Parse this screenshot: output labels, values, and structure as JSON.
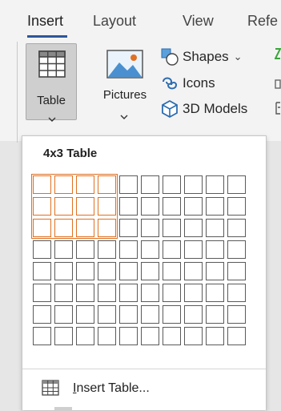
{
  "ribbon": {
    "tabs": [
      {
        "label": "Insert",
        "active": true
      },
      {
        "label": "Layout",
        "active": false
      },
      {
        "label": "View",
        "active": false
      },
      {
        "label": "Refe",
        "active": false
      }
    ],
    "table_button": {
      "label": "Table",
      "icon": "table-icon",
      "pressed": true
    },
    "pictures_button": {
      "label": "Pictures",
      "icon": "pictures-icon"
    },
    "shapes": {
      "label": "Shapes",
      "icon": "shapes-icon",
      "chevron": "⌄"
    },
    "icons": {
      "label": "Icons",
      "icon": "icons-icon"
    },
    "models": {
      "label": "3D Models",
      "icon": "3d-models-icon"
    }
  },
  "dropdown": {
    "title": "4x3 Table",
    "grid": {
      "columns": 10,
      "rows": 8,
      "selected_columns": 4,
      "selected_rows": 3
    },
    "insert_table": {
      "mnemonic": "I",
      "label_rest": "nsert Table...",
      "icon": "table-icon"
    }
  },
  "colors": {
    "accent": "#2b579a",
    "highlight": "#e07020",
    "pressed_bg": "#cfcfcf"
  }
}
